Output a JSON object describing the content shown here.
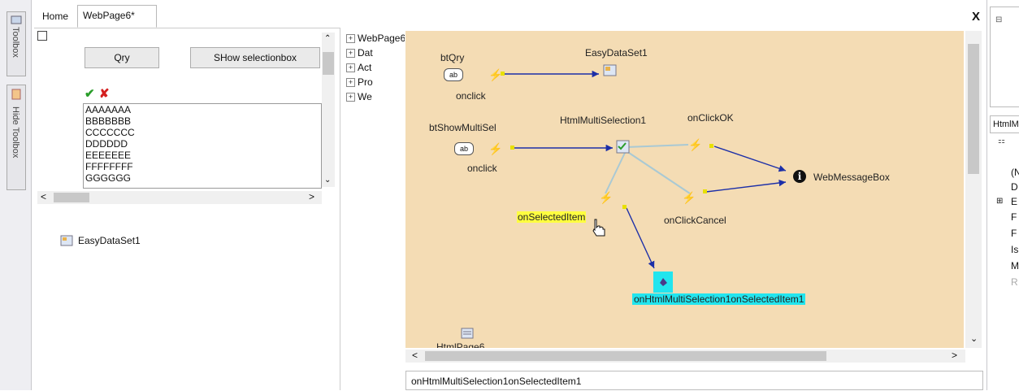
{
  "toolbox": {
    "toolbox_label": "Toolbox",
    "hide_label": "Hide Toolbox"
  },
  "tabs": [
    {
      "label": "Home"
    },
    {
      "label": "WebPage6*"
    }
  ],
  "close_label": "X",
  "designer": {
    "qry_button": "Qry",
    "show_button": "SHow selectionbox",
    "check_icon": "check-icon",
    "cross_icon": "cross-icon",
    "list_items": [
      "AAAAAAA",
      "BBBBBBB",
      "CCCCCCC",
      "DDDDDD",
      "EEEEEEE",
      "FFFFFFFF",
      "GGGGGG"
    ],
    "dataset_label": "EasyDataSet1"
  },
  "tree": {
    "items": [
      "WebPage6",
      "Dat",
      "Act",
      "Pro",
      "We"
    ]
  },
  "canvas": {
    "nodes": {
      "btQry": "btQry",
      "onclick1": "onclick",
      "easydataset": "EasyDataSet1",
      "btShowMultiSel": "btShowMultiSel",
      "onclick2": "onclick",
      "multiselection": "HtmlMultiSelection1",
      "onClickOK": "onClickOK",
      "webmessagebox": "WebMessageBox",
      "onClickCancel": "onClickCancel",
      "onSelectedItem": "onSelectedItem",
      "handler": "onHtmlMultiSelection1onSelectedItem1",
      "ab_label": "ab",
      "bottom_label": "HtmlPage6"
    },
    "colors": {
      "background": "#f4dcb4",
      "arrow": "#1c2fa8",
      "connector": "#a9c9d4",
      "highlight_yellow": "#ffff40",
      "highlight_cyan": "#22e5ee"
    }
  },
  "status_text": "onHtmlMultiSelection1onSelectedItem1",
  "right_panel": {
    "header": "HtmlM",
    "rows": [
      "(N",
      "D",
      "E",
      "F",
      "F",
      "Is",
      "M",
      "R"
    ]
  }
}
